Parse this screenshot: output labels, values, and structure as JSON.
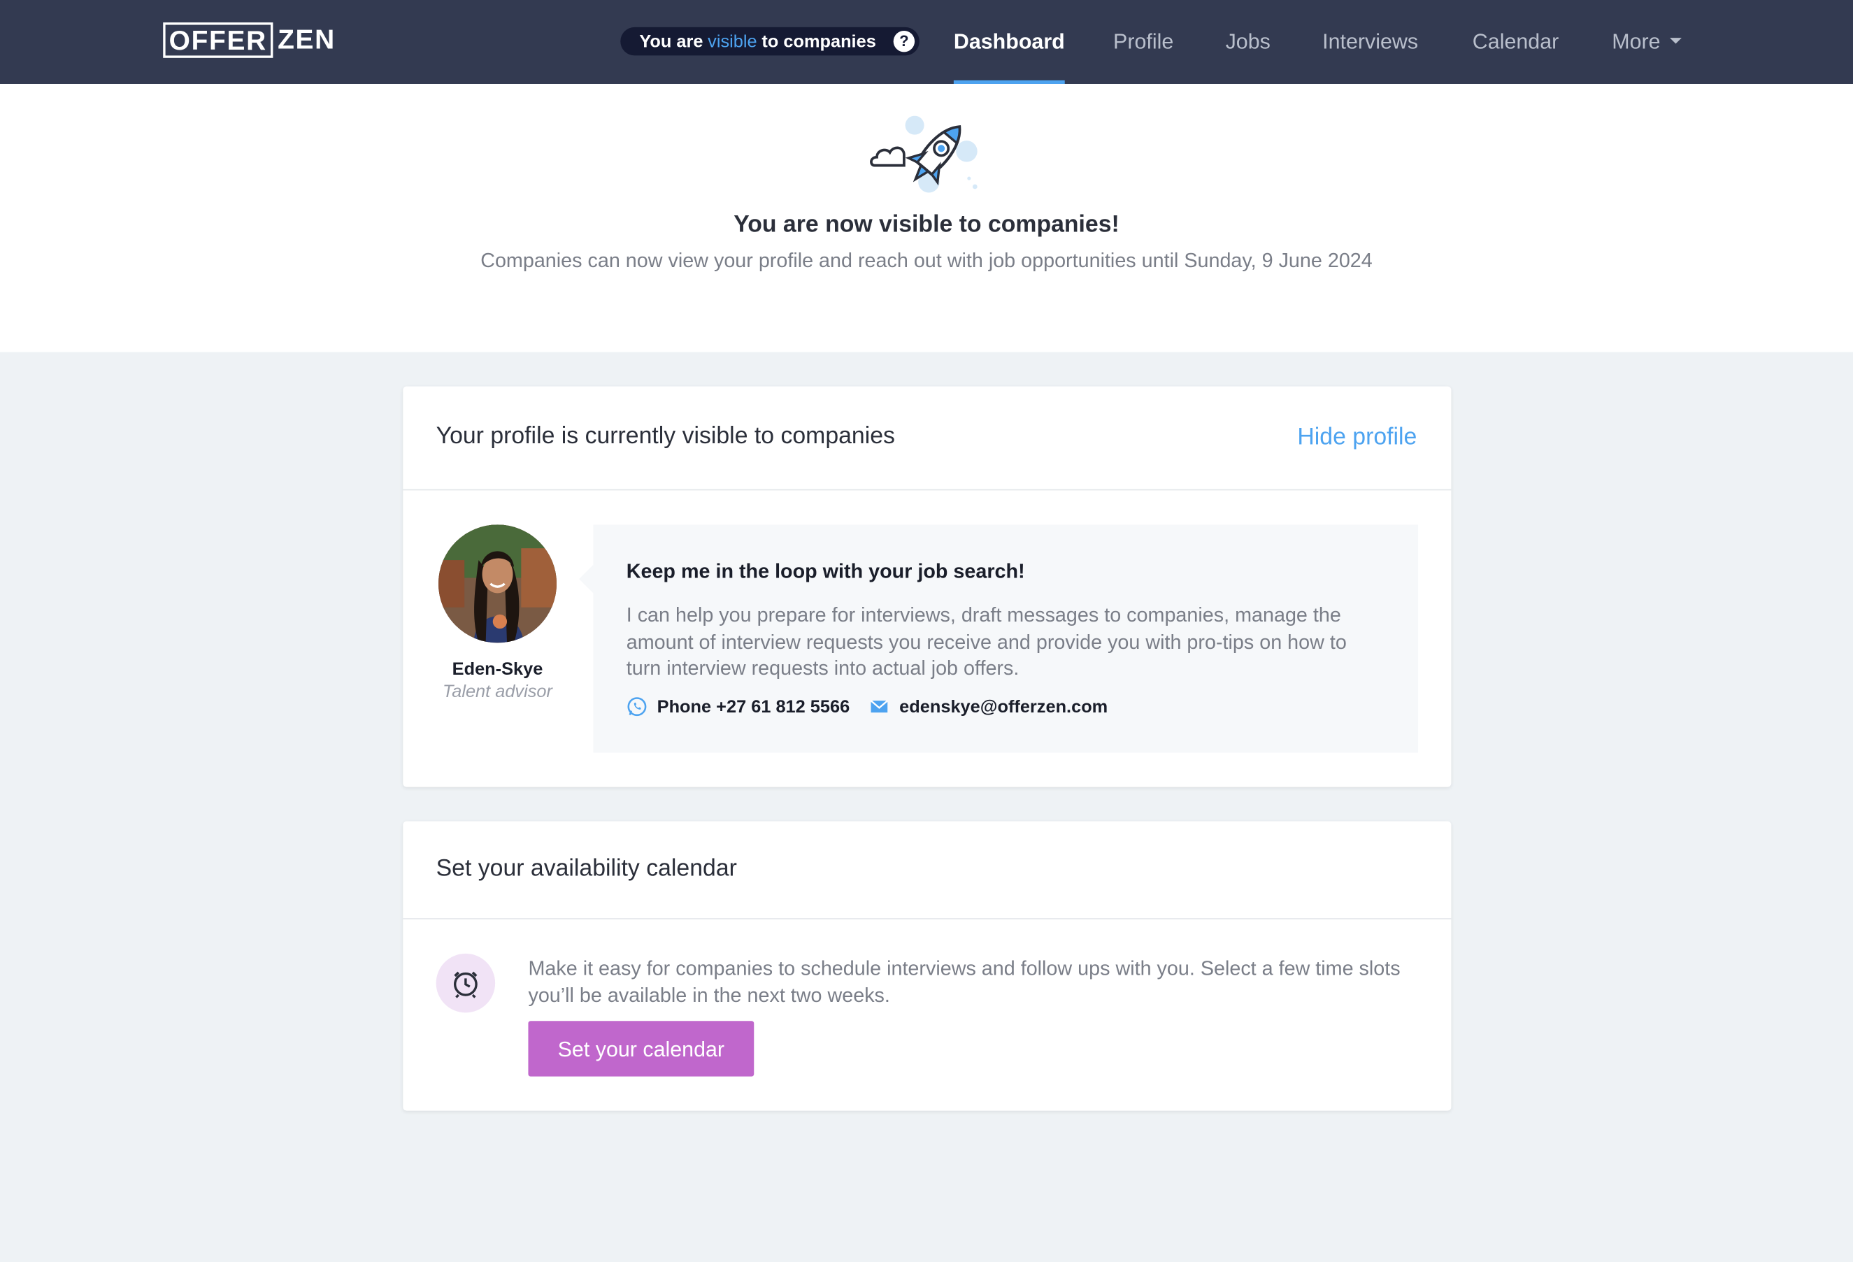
{
  "navbar": {
    "logo_boxed": "OFFER",
    "logo_plain": "ZEN",
    "visibility_pill": {
      "prefix": "You are",
      "highlight": "visible",
      "suffix": "to companies",
      "help_glyph": "?"
    },
    "items": [
      {
        "label": "Dashboard",
        "active": true
      },
      {
        "label": "Profile",
        "active": false
      },
      {
        "label": "Jobs",
        "active": false
      },
      {
        "label": "Interviews",
        "active": false
      },
      {
        "label": "Calendar",
        "active": false
      },
      {
        "label": "More",
        "active": false,
        "has_dropdown": true
      }
    ]
  },
  "hero": {
    "icon": "rocket-icon",
    "title": "You are now visible to companies!",
    "subtitle": "Companies can now view your profile and reach out with job opportunities until Sunday, 9 June 2024"
  },
  "profile_card": {
    "title": "Your profile is currently visible to companies",
    "hide_link": "Hide profile",
    "advisor": {
      "name": "Eden-Skye",
      "role": "Talent advisor"
    },
    "message": {
      "title": "Keep me in the loop with your job search!",
      "body": "I can help you prepare for interviews, draft messages to companies, manage the amount of interview requests you receive and provide you with pro-tips on how to turn interview requests into actual job offers.",
      "phone": "Phone +27 61 812 5566",
      "email": "edenskye@offerzen.com"
    }
  },
  "calendar_card": {
    "title": "Set your availability calendar",
    "text": "Make it easy for companies to schedule interviews and follow ups with you. Select a few time slots you’ll be available in the next two weeks.",
    "button": "Set your calendar"
  },
  "colors": {
    "navbar_bg": "#333a51",
    "accent_blue": "#4da3f0",
    "button_purple": "#c067cc",
    "page_bg": "#eef2f5"
  }
}
